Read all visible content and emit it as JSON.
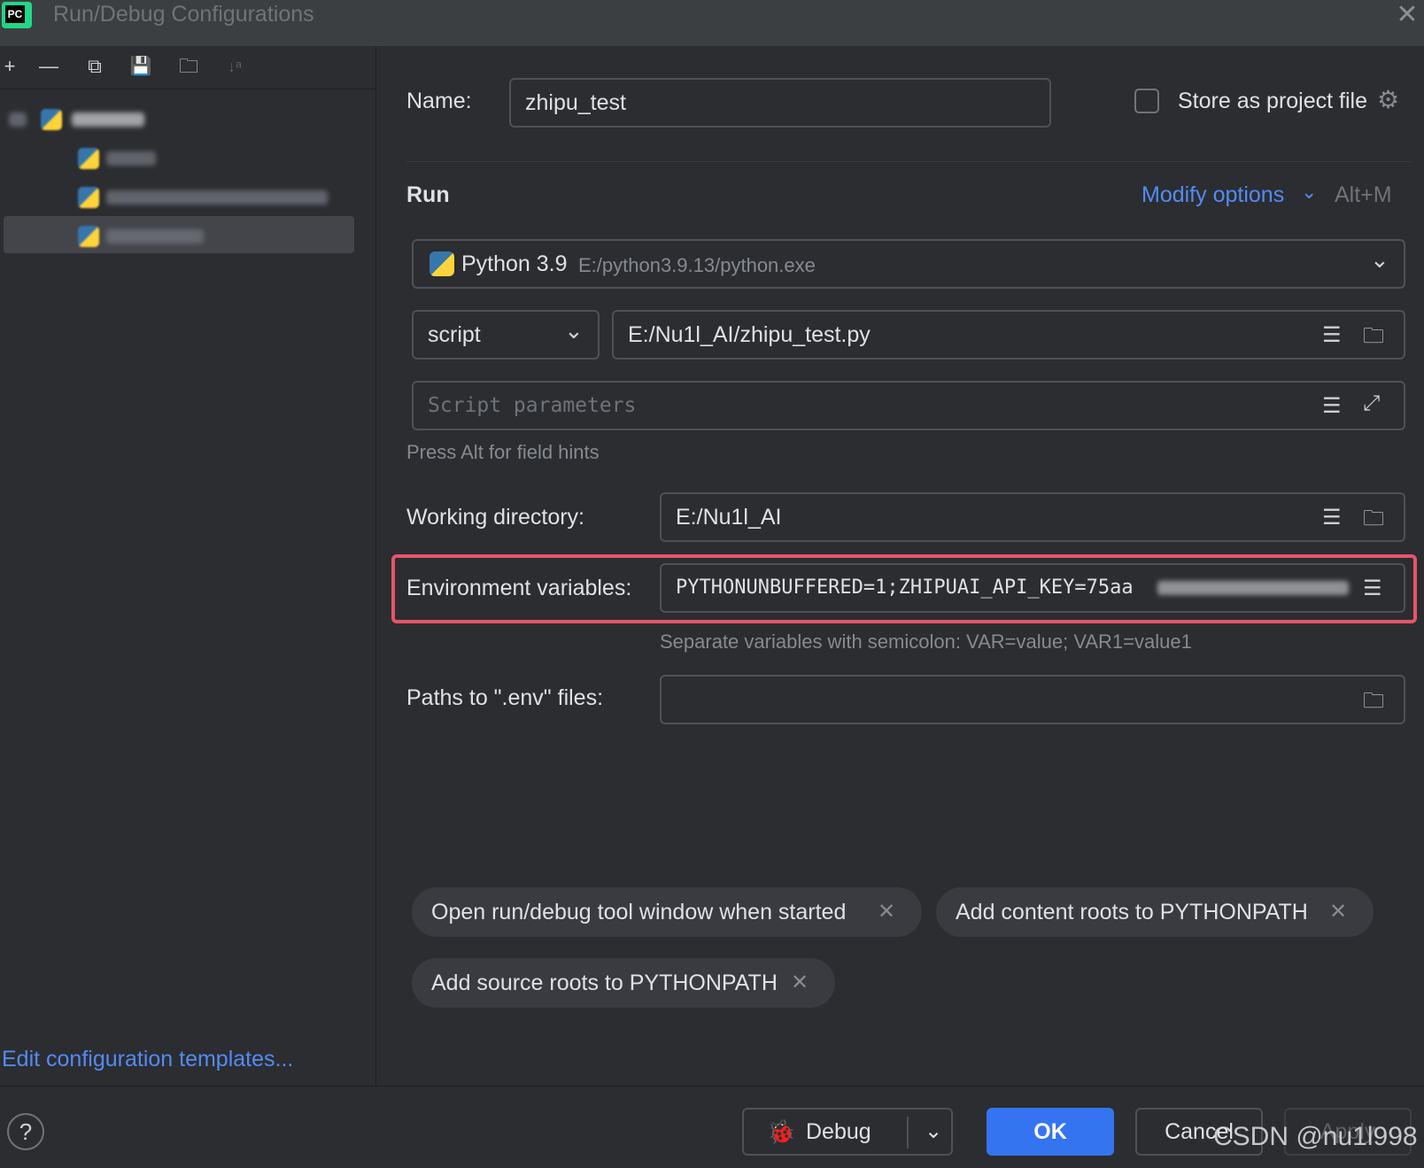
{
  "window": {
    "title": "Run/Debug Configurations",
    "app_icon_text": "PC",
    "close_glyph": "✕"
  },
  "toolbar": {
    "add": "+",
    "remove": "—",
    "copy": "⧉",
    "save": "💾",
    "folder": "🗀",
    "sort": "↓ᵃ"
  },
  "footer_left": {
    "edit_templates": "Edit configuration templates..."
  },
  "form": {
    "name_label": "Name:",
    "name_value": "zhipu_test",
    "store_label": "Store as project file",
    "run_section": "Run",
    "modify_options": "Modify options",
    "modify_shortcut": "Alt+M",
    "interpreter_name": "Python 3.9",
    "interpreter_path": "E:/python3.9.13/python.exe",
    "script_mode": "script",
    "script_path": "E:/Nu1l_AI/zhipu_test.py",
    "script_params_placeholder": "Script parameters",
    "field_hint": "Press Alt for field hints",
    "workdir_label": "Working directory:",
    "workdir_value": "E:/Nu1l_AI",
    "env_label": "Environment variables:",
    "env_value": "PYTHONUNBUFFERED=1;ZHIPUAI_API_KEY=75aa",
    "env_hint": "Separate variables with semicolon: VAR=value; VAR1=value1",
    "dotenv_label": "Paths to \".env\" files:",
    "dotenv_value": ""
  },
  "chips": [
    {
      "label": "Open run/debug tool window when started"
    },
    {
      "label": "Add content roots to PYTHONPATH"
    },
    {
      "label": "Add source roots to PYTHONPATH"
    }
  ],
  "buttons": {
    "help": "?",
    "debug": "Debug",
    "ok": "OK",
    "cancel": "Cancel",
    "apply": "Apply"
  },
  "watermark": "CSDN @nu1l998",
  "colors": {
    "accent": "#3574f0",
    "link": "#548af7",
    "highlight_box": "#e5556a"
  }
}
